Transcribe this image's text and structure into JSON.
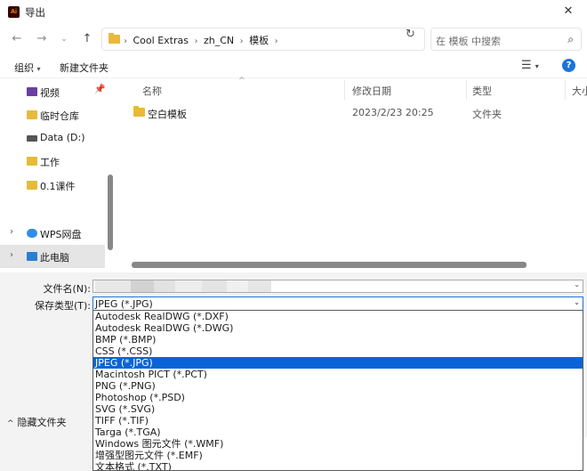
{
  "window": {
    "title": "导出",
    "app_icon": "Ai"
  },
  "address": {
    "breadcrumbs": [
      "Cool Extras",
      "zh_CN",
      "模板"
    ],
    "search_placeholder": "在 模板 中搜索"
  },
  "toolbar": {
    "organize": "组织",
    "new_folder": "新建文件夹"
  },
  "nav": {
    "items": [
      {
        "label": "视频",
        "icon": "video-icon"
      },
      {
        "label": "临时仓库",
        "icon": "folder-icon"
      },
      {
        "label": "Data (D:)",
        "icon": "drive-icon"
      },
      {
        "label": "工作",
        "icon": "folder-icon"
      },
      {
        "label": "0.1课件",
        "icon": "folder-icon"
      },
      {
        "label": "WPS网盘",
        "icon": "cloud-icon"
      },
      {
        "label": "此电脑",
        "icon": "computer-icon"
      }
    ]
  },
  "files": {
    "columns": [
      "名称",
      "修改日期",
      "类型",
      "大小"
    ],
    "rows": [
      {
        "name": "空白模板",
        "date": "2023/2/23 20:25",
        "type": "文件夹"
      }
    ]
  },
  "form": {
    "filename_label": "文件名(N):",
    "filetype_label": "保存类型(T):",
    "filetype_value": "JPEG (*.JPG)",
    "options": [
      "Autodesk RealDWG (*.DXF)",
      "Autodesk RealDWG (*.DWG)",
      "BMP (*.BMP)",
      "CSS (*.CSS)",
      "JPEG (*.JPG)",
      "Macintosh PICT (*.PCT)",
      "PNG (*.PNG)",
      "Photoshop (*.PSD)",
      "SVG (*.SVG)",
      "TIFF (*.TIF)",
      "Targa (*.TGA)",
      "Windows 图元文件 (*.WMF)",
      "增强型图元文件 (*.EMF)",
      "文本格式 (*.TXT)"
    ],
    "selected_index": 4
  },
  "footer": {
    "hide_folders": "隐藏文件夹"
  },
  "colors": {
    "accent": "#0a64d6",
    "folder": "#e8b93a"
  }
}
